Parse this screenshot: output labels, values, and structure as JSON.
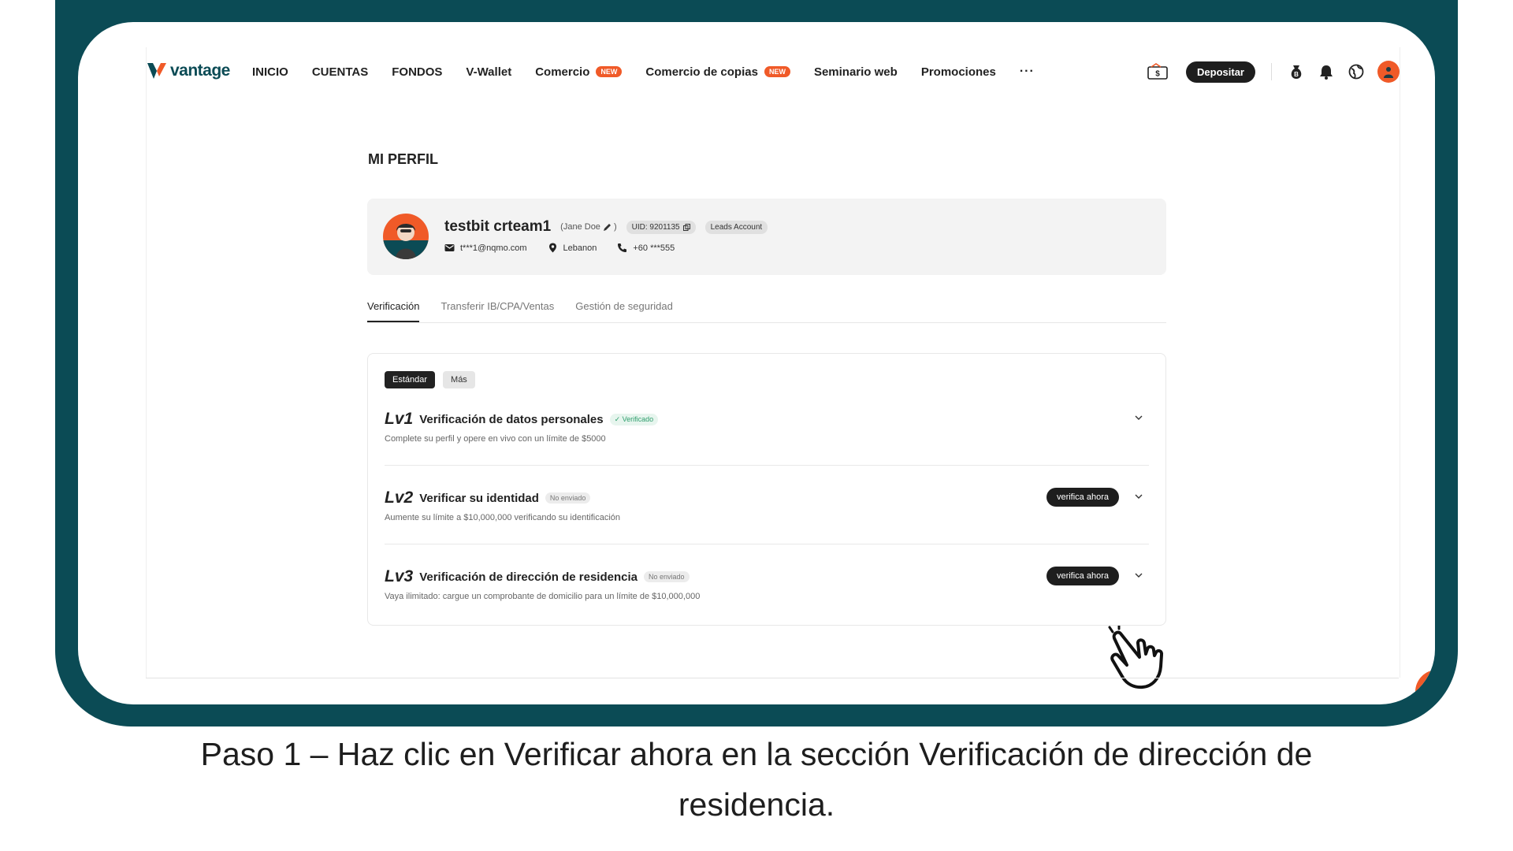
{
  "brand": {
    "name": "vantage",
    "color": "#0b4b55",
    "accent": "#f05a28"
  },
  "nav": {
    "items": [
      {
        "label": "INICIO",
        "badge": ""
      },
      {
        "label": "CUENTAS",
        "badge": ""
      },
      {
        "label": "FONDOS",
        "badge": ""
      },
      {
        "label": "V-Wallet",
        "badge": ""
      },
      {
        "label": "Comercio",
        "badge": "NEW"
      },
      {
        "label": "Comercio de copias",
        "badge": "NEW"
      },
      {
        "label": "Seminario web",
        "badge": ""
      },
      {
        "label": "Promociones",
        "badge": ""
      }
    ],
    "more": "···",
    "deposit_label": "Depositar"
  },
  "page": {
    "title": "MI PERFIL"
  },
  "profile": {
    "name": "testbit crteam1",
    "alias": "(Jane Doe",
    "uid": "UID: 9201135",
    "account_type": "Leads Account",
    "email": "t***1@nqmo.com",
    "country": "Lebanon",
    "phone": "+60 ***555"
  },
  "tabs": [
    {
      "label": "Verificación"
    },
    {
      "label": "Transferir IB/CPA/Ventas"
    },
    {
      "label": "Gestión de seguridad"
    }
  ],
  "segments": {
    "standard": "Estándar",
    "more": "Más"
  },
  "levels": [
    {
      "tag": "Lv1",
      "title": "Verificación de datos personales",
      "status": "✓ Verificado",
      "desc": "Complete su perfil y opere en vivo con un límite de $5000",
      "action": ""
    },
    {
      "tag": "Lv2",
      "title": "Verificar su identidad",
      "status": "No enviado",
      "desc": "Aumente su límite a $10,000,000 verificando su identificación",
      "action": "verifica ahora"
    },
    {
      "tag": "Lv3",
      "title": "Verificación de dirección de residencia",
      "status": "No enviado",
      "desc": "Vaya ilimitado: cargue un comprobante de domicilio para un límite de $10,000,000",
      "action": "verifica ahora"
    }
  ],
  "caption": {
    "line1": "Paso 1 – Haz clic en Verificar ahora en la sección Verificación de dirección de",
    "line2": "residencia."
  }
}
